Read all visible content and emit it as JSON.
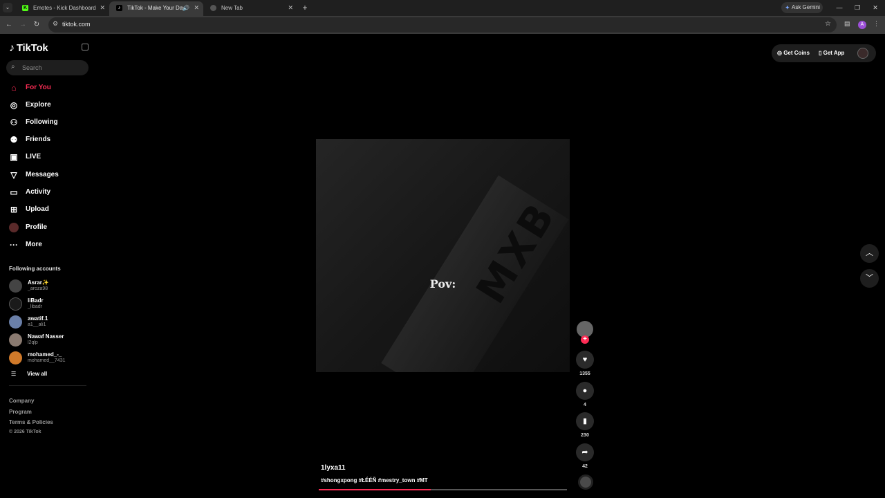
{
  "browser": {
    "tabs": [
      {
        "title": "Emotes - Kick Dashboard",
        "favicon": "K"
      },
      {
        "title": "TikTok - Make Your Day",
        "favicon": "♪"
      },
      {
        "title": "New Tab",
        "favicon": ""
      }
    ],
    "new_tab_label": "+",
    "gemini_label": "Ask Gemini",
    "url": "tiktok.com",
    "profile_initial": "A"
  },
  "sidebar": {
    "logo": "TikTok",
    "search_placeholder": "Search",
    "nav": [
      {
        "label": "For You",
        "icon": "home-icon",
        "active": true
      },
      {
        "label": "Explore",
        "icon": "compass-icon"
      },
      {
        "label": "Following",
        "icon": "following-icon"
      },
      {
        "label": "Friends",
        "icon": "friends-icon"
      },
      {
        "label": "LIVE",
        "icon": "live-icon"
      },
      {
        "label": "Messages",
        "icon": "send-icon"
      },
      {
        "label": "Activity",
        "icon": "activity-icon"
      },
      {
        "label": "Upload",
        "icon": "upload-icon"
      },
      {
        "label": "Profile",
        "icon": "profile-icon"
      },
      {
        "label": "More",
        "icon": "more-icon"
      }
    ],
    "following_title": "Following accounts",
    "accounts": [
      {
        "name": "Asrar✨",
        "handle": "_aroza98"
      },
      {
        "name": "liBadr",
        "handle": "_libadr"
      },
      {
        "name": "awatif.1",
        "handle": "a1__ali1"
      },
      {
        "name": "Nawaf Nasser",
        "handle": "l2qlp"
      },
      {
        "name": "mohamed_-_",
        "handle": "mohamed__7431"
      }
    ],
    "view_all": "View all",
    "footer": [
      "Company",
      "Program",
      "Terms & Policies"
    ],
    "copyright": "© 2026 TikTok"
  },
  "topbar": {
    "get_coins": "Get Coins",
    "get_app": "Get App"
  },
  "video": {
    "caption_overlay": "Pov:",
    "engraving": "MXB",
    "author": "1lyxa11",
    "tags": "#shongxpong #ŁÉÉÑ #mestry_town #MT",
    "progress": 0.45
  },
  "actions": {
    "likes": "1355",
    "comments": "4",
    "saves": "230",
    "shares": "42"
  },
  "colors": {
    "accent": "#fe2c55",
    "background": "#000000"
  }
}
